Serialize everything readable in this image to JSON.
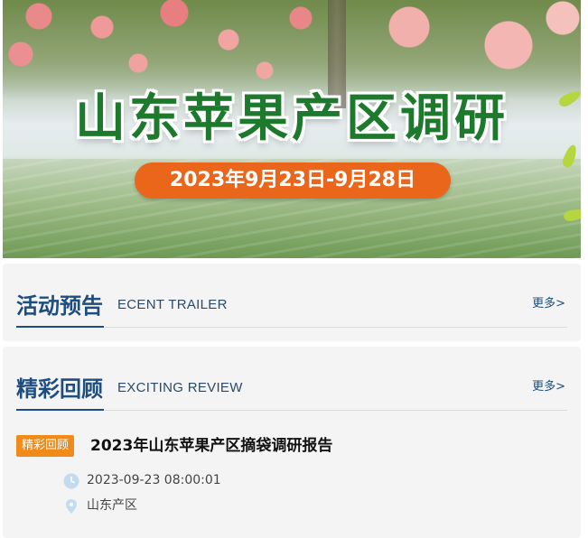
{
  "banner": {
    "title": "山东苹果产区调研",
    "date_range": "2023年9月23日-9月28日"
  },
  "preview_section": {
    "title": "活动预告",
    "subtitle": "ECENT TRAILER",
    "more_label": "更多>"
  },
  "review_section": {
    "title": "精彩回顾",
    "subtitle": "EXCITING REVIEW",
    "more_label": "更多>",
    "items": [
      {
        "tag": "精彩回顾",
        "title": "2023年山东苹果产区摘袋调研报告",
        "time": "2023-09-23 08:00:01",
        "location": "山东产区"
      }
    ]
  },
  "colors": {
    "accent_blue": "#1e4d80",
    "tag_orange": "#f08a18",
    "banner_green": "#1d7a2c",
    "date_orange": "#e9661a"
  },
  "icons": {
    "time": "clock-icon",
    "location": "location-pin-icon"
  }
}
